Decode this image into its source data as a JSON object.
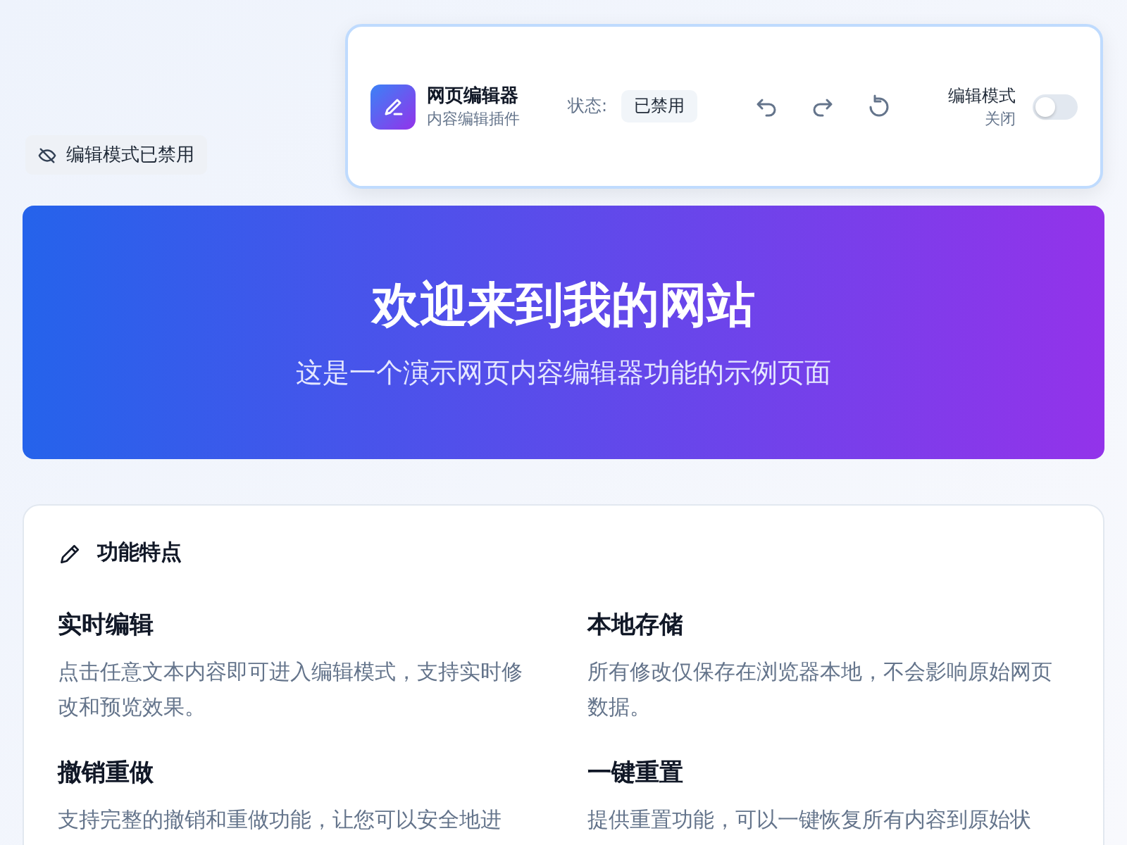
{
  "toolbar": {
    "title": "网页编辑器",
    "subtitle": "内容编辑插件",
    "status_label": "状态:",
    "status_value": "已禁用",
    "edit_mode": {
      "label": "编辑模式",
      "state_text": "关闭",
      "on": false
    }
  },
  "mode_badge": {
    "text": "编辑模式已禁用",
    "enabled": false
  },
  "hero": {
    "title": "欢迎来到我的网站",
    "subtitle": "这是一个演示网页内容编辑器功能的示例页面"
  },
  "features": {
    "title": "功能特点",
    "items": [
      {
        "title": "实时编辑",
        "text": "点击任意文本内容即可进入编辑模式，支持实时修改和预览效果。"
      },
      {
        "title": "本地存储",
        "text": "所有修改仅保存在浏览器本地，不会影响原始网页数据。"
      },
      {
        "title": "撤销重做",
        "text": "支持完整的撤销和重做功能，让您可以安全地进"
      },
      {
        "title": "一键重置",
        "text": "提供重置功能，可以一键恢复所有内容到原始状"
      }
    ]
  }
}
